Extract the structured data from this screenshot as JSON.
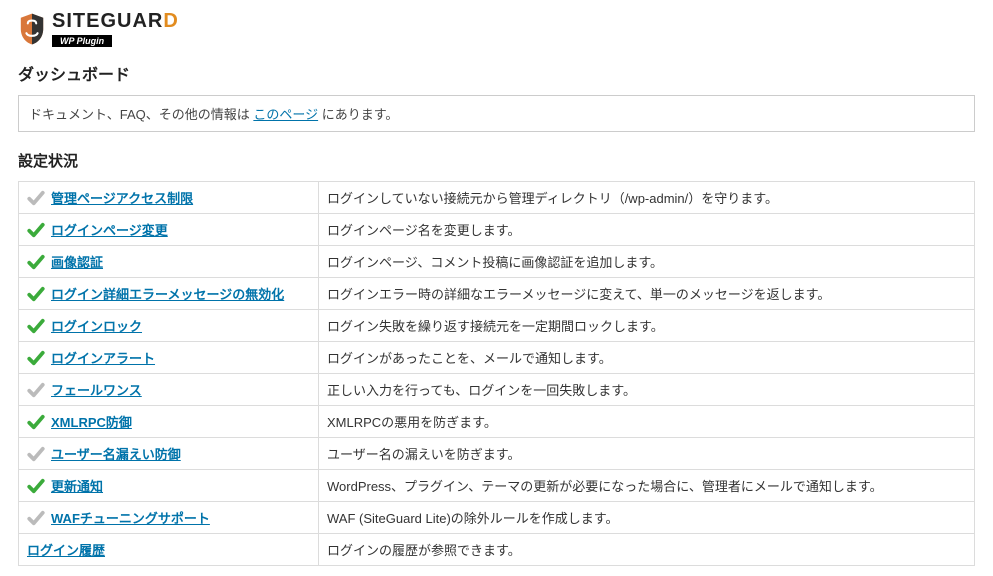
{
  "logo": {
    "brand_prefix": "SITEGUAR",
    "brand_suffix": "D",
    "subtitle": "WP Plugin"
  },
  "page_title": "ダッシュボード",
  "info": {
    "prefix": "ドキュメント、FAQ、その他の情報は ",
    "link_text": "このページ",
    "suffix": " にあります。"
  },
  "section_title": "設定状況",
  "rows": [
    {
      "enabled": false,
      "name": "管理ページアクセス制限",
      "desc": "ログインしていない接続元から管理ディレクトリ（/wp-admin/）を守ります。"
    },
    {
      "enabled": true,
      "name": "ログインページ変更",
      "desc": "ログインページ名を変更します。"
    },
    {
      "enabled": true,
      "name": "画像認証",
      "desc": "ログインページ、コメント投稿に画像認証を追加します。"
    },
    {
      "enabled": true,
      "name": "ログイン詳細エラーメッセージの無効化",
      "desc": "ログインエラー時の詳細なエラーメッセージに変えて、単一のメッセージを返します。"
    },
    {
      "enabled": true,
      "name": "ログインロック",
      "desc": "ログイン失敗を繰り返す接続元を一定期間ロックします。"
    },
    {
      "enabled": true,
      "name": "ログインアラート",
      "desc": "ログインがあったことを、メールで通知します。"
    },
    {
      "enabled": false,
      "name": "フェールワンス",
      "desc": "正しい入力を行っても、ログインを一回失敗します。"
    },
    {
      "enabled": true,
      "name": "XMLRPC防御",
      "desc": "XMLRPCの悪用を防ぎます。"
    },
    {
      "enabled": false,
      "name": "ユーザー名漏えい防御",
      "desc": "ユーザー名の漏えいを防ぎます。"
    },
    {
      "enabled": true,
      "name": "更新通知",
      "desc": "WordPress、プラグイン、テーマの更新が必要になった場合に、管理者にメールで通知します。"
    },
    {
      "enabled": false,
      "name": "WAFチューニングサポート",
      "desc": "WAF (SiteGuard Lite)の除外ルールを作成します。"
    },
    {
      "enabled": null,
      "name": "ログイン履歴",
      "desc": "ログインの履歴が参照できます。"
    }
  ]
}
